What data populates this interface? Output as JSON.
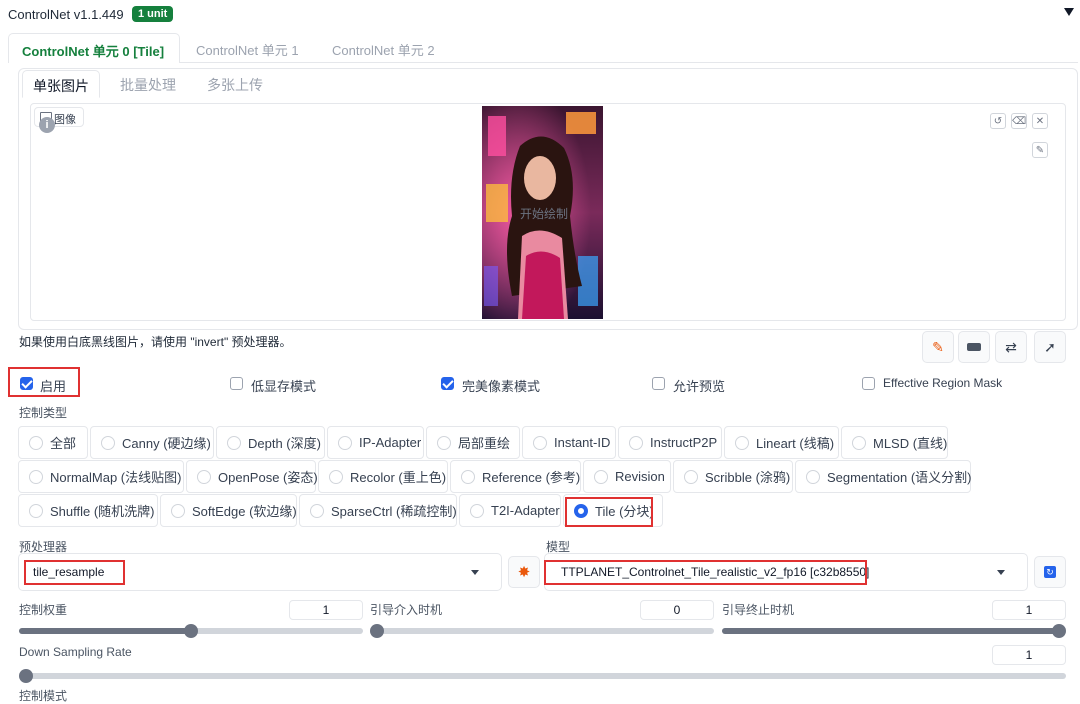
{
  "header": {
    "title": "ControlNet v1.1.449",
    "badge": "1 unit",
    "collapse_icon": "triangle-down-icon"
  },
  "unit_tabs": [
    "ControlNet 单元 0 [Tile]",
    "ControlNet 单元 1",
    "ControlNet 单元 2"
  ],
  "image_tabs": [
    "单张图片",
    "批量处理",
    "多张上传"
  ],
  "image_panel": {
    "label": "图像",
    "overlay_text": "开始绘制"
  },
  "hint": "如果使用白底黑线图片，请使用 \"invert\" 预处理器。",
  "checkboxes": [
    {
      "label": "启用",
      "checked": true
    },
    {
      "label": "低显存模式",
      "checked": false
    },
    {
      "label": "完美像素模式",
      "checked": true
    },
    {
      "label": "允许预览",
      "checked": false
    },
    {
      "label": "Effective Region Mask",
      "checked": false
    }
  ],
  "control_type": {
    "label": "控制类型",
    "options": [
      "全部",
      "Canny (硬边缘)",
      "Depth (深度)",
      "IP-Adapter",
      "局部重绘",
      "Instant-ID",
      "InstructP2P",
      "Lineart (线稿)",
      "MLSD (直线)",
      "NormalMap (法线贴图)",
      "OpenPose (姿态)",
      "Recolor (重上色)",
      "Reference (参考)",
      "Revision",
      "Scribble (涂鸦)",
      "Segmentation (语义分割)",
      "Shuffle (随机洗牌)",
      "SoftEdge (软边缘)",
      "SparseCtrl (稀疏控制)",
      "T2I-Adapter",
      "Tile (分块)"
    ],
    "selected": "Tile (分块)"
  },
  "preprocessor": {
    "label": "预处理器",
    "value": "tile_resample"
  },
  "model": {
    "label": "模型",
    "value": "TTPLANET_Controlnet_Tile_realistic_v2_fp16 [c32b8550]"
  },
  "sliders": {
    "control_weight": {
      "label": "控制权重",
      "value": "1",
      "fraction": 0.5
    },
    "start_step": {
      "label": "引导介入时机",
      "value": "0",
      "fraction": 0.0
    },
    "end_step": {
      "label": "引导终止时机",
      "value": "1",
      "fraction": 1.0
    },
    "down_sampling": {
      "label": "Down Sampling Rate",
      "value": "1",
      "fraction": 0.0
    }
  },
  "footer_label": "控制模式",
  "colors": {
    "accent": "#2563eb",
    "highlight": "#e03131",
    "badge": "#15803d",
    "active_tab": "#15803d"
  }
}
